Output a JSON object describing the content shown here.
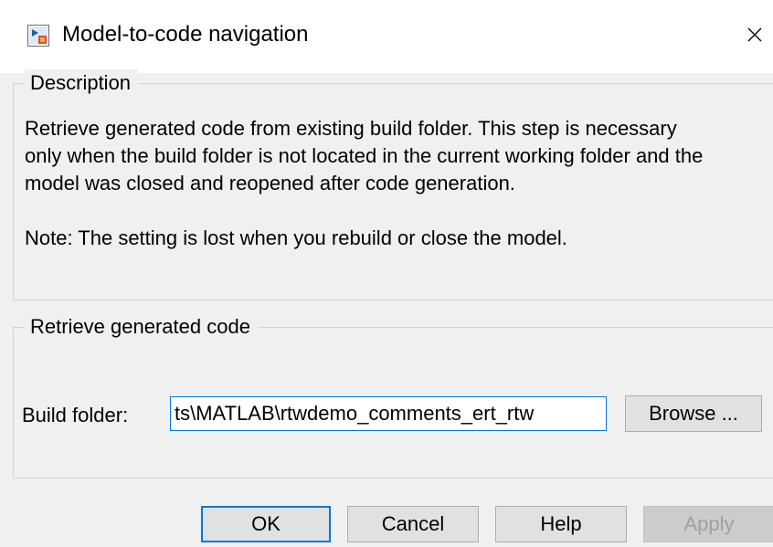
{
  "window": {
    "title": "Model-to-code navigation",
    "icon": "simulink-model-icon",
    "close_glyph": "✕"
  },
  "description": {
    "group_title": "Description",
    "text": "Retrieve generated code from existing build folder. This step is necessary only when the build folder is not located in the current working folder and the model was closed and reopened after code generation.",
    "note": "Note: The setting is lost when you rebuild or close the model."
  },
  "retrieve": {
    "group_title": "Retrieve generated code",
    "build_folder_label": "Build folder:",
    "build_folder_value": "ts\\MATLAB\\rtwdemo_comments_ert_rtw",
    "browse_label": "Browse ..."
  },
  "buttons": {
    "ok": "OK",
    "cancel": "Cancel",
    "help": "Help",
    "apply": "Apply",
    "apply_enabled": false
  },
  "colors": {
    "focus_accent": "#0078d7",
    "dialog_background": "#f0f0f0",
    "title_bar": "#ffffff"
  }
}
